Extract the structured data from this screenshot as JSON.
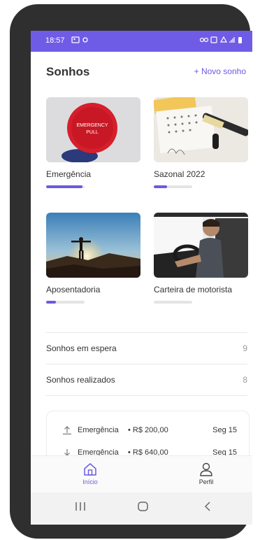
{
  "status_bar": {
    "time": "18:57"
  },
  "header": {
    "title": "Sonhos",
    "new_dream_label": "+ Novo sonho"
  },
  "dreams": [
    {
      "label": "Emergência",
      "image": "emergency-pull-button",
      "progress": 0.95
    },
    {
      "label": "Sazonal 2022",
      "image": "calendar-with-pen",
      "progress": 0.35
    },
    {
      "label": "Aposentadoria",
      "image": "person-at-sunset",
      "progress": 0.25
    },
    {
      "label": "Carteira de motorista",
      "image": "person-driving-car",
      "progress": 0.0
    }
  ],
  "summary": [
    {
      "label": "Sonhos em espera",
      "count": "9"
    },
    {
      "label": "Sonhos realizados",
      "count": "8"
    }
  ],
  "transactions": [
    {
      "direction": "up-arrow-icon",
      "label": "Emergência",
      "amount": "R$ 200,00",
      "day": "Seg 15"
    },
    {
      "direction": "down-arrow-icon",
      "label": "Emergência",
      "amount": "R$ 640,00",
      "day": "Seg 15"
    }
  ],
  "bottom_nav": [
    {
      "label": "Início",
      "icon": "home-icon",
      "active": true
    },
    {
      "label": "Perfil",
      "icon": "user-icon",
      "active": false
    }
  ],
  "colors": {
    "accent": "#6b5ae0",
    "status_bar": "#6f5ce6"
  }
}
